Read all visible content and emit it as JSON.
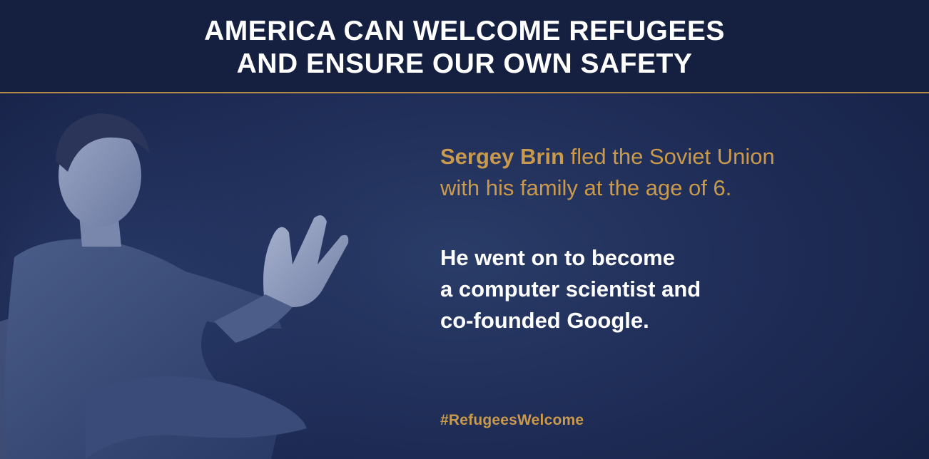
{
  "banner": {
    "headline_line1": "AMERICA CAN WELCOME REFUGEES",
    "headline_line2": "AND ENSURE OUR OWN SAFETY"
  },
  "story": {
    "name": "Sergey Brin",
    "lead_rest": " fled the Soviet Union",
    "lead_line2": "with his family at the age of 6.",
    "body_lines": [
      "He went on to become",
      "a computer scientist and",
      "co-founded Google."
    ]
  },
  "hashtag": "#RefugeesWelcome",
  "colors": {
    "background": "#1e2c56",
    "banner": "#152040",
    "accent_gold": "#c99a4c",
    "text_white": "#ffffff"
  }
}
